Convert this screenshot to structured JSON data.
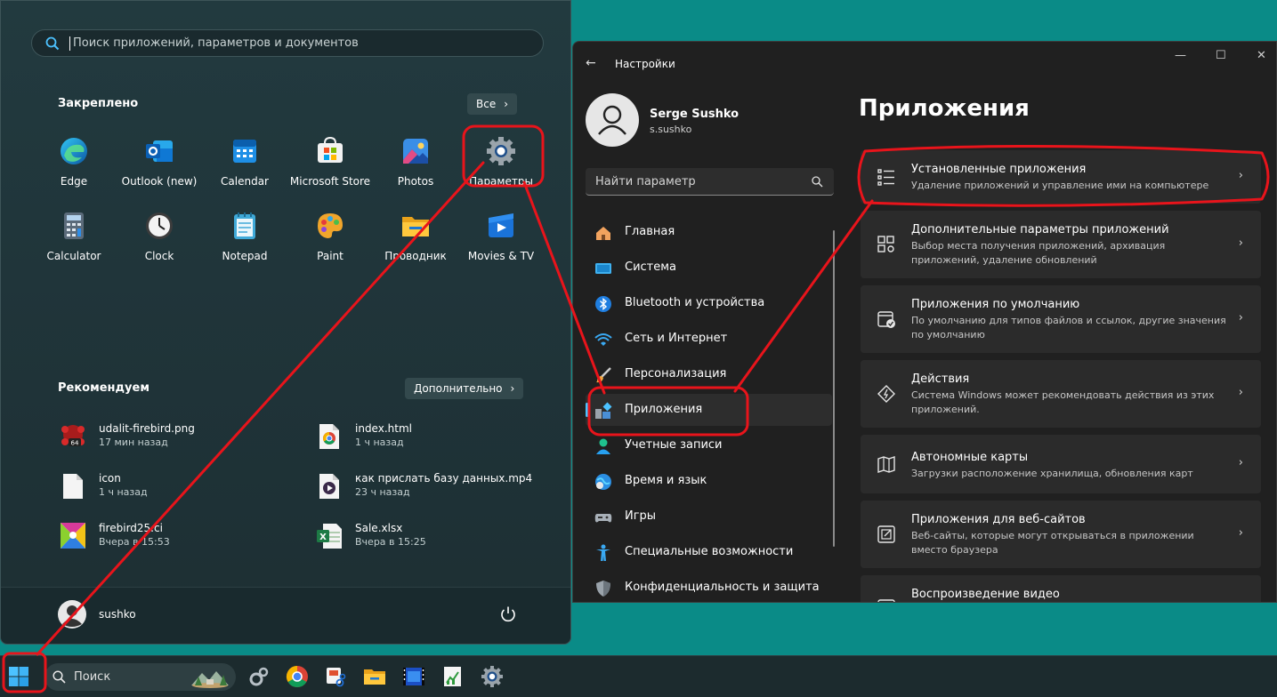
{
  "start_menu": {
    "search_placeholder": "Поиск приложений, параметров и документов",
    "pinned_title": "Закреплено",
    "all_label": "Все",
    "pinned": [
      {
        "label": "Edge",
        "icon": "edge-icon"
      },
      {
        "label": "Outlook (new)",
        "icon": "outlook-icon"
      },
      {
        "label": "Calendar",
        "icon": "calendar-icon"
      },
      {
        "label": "Microsoft Store",
        "icon": "store-icon"
      },
      {
        "label": "Photos",
        "icon": "photos-icon"
      },
      {
        "label": "Параметры",
        "icon": "settings-gear-icon"
      },
      {
        "label": "Calculator",
        "icon": "calculator-icon"
      },
      {
        "label": "Clock",
        "icon": "clock-icon"
      },
      {
        "label": "Notepad",
        "icon": "notepad-icon"
      },
      {
        "label": "Paint",
        "icon": "paint-icon"
      },
      {
        "label": "Проводник",
        "icon": "folder-icon"
      },
      {
        "label": "Movies & TV",
        "icon": "movies-icon"
      }
    ],
    "recommended_title": "Рекомендуем",
    "more_label": "Дополнительно",
    "recommended": [
      {
        "name": "udalit-firebird.png",
        "time": "17 мин назад",
        "icon": "png-file-icon"
      },
      {
        "name": "index.html",
        "time": "1 ч назад",
        "icon": "chrome-html-icon"
      },
      {
        "name": "icon",
        "time": "1 ч назад",
        "icon": "blank-file-icon"
      },
      {
        "name": "как прислать базу данных.mp4",
        "time": "23 ч назад",
        "icon": "video-file-icon"
      },
      {
        "name": "firebird25.ci",
        "time": "Вчера в 15:53",
        "icon": "image-file-icon"
      },
      {
        "name": "Sale.xlsx",
        "time": "Вчера в 15:25",
        "icon": "excel-file-icon"
      }
    ],
    "user_name": "sushko"
  },
  "settings": {
    "window_title": "Настройки",
    "user_full_name": "Serge Sushko",
    "user_login": "s.sushko",
    "search_placeholder": "Найти параметр",
    "page_title": "Приложения",
    "nav": [
      {
        "label": "Главная",
        "icon": "home-icon"
      },
      {
        "label": "Система",
        "icon": "system-icon"
      },
      {
        "label": "Bluetooth и устройства",
        "icon": "bluetooth-icon"
      },
      {
        "label": "Сеть и Интернет",
        "icon": "wifi-icon"
      },
      {
        "label": "Персонализация",
        "icon": "brush-icon"
      },
      {
        "label": "Приложения",
        "icon": "apps-icon",
        "selected": true
      },
      {
        "label": "Учетные записи",
        "icon": "account-icon"
      },
      {
        "label": "Время и язык",
        "icon": "globe-clock-icon"
      },
      {
        "label": "Игры",
        "icon": "gamepad-icon"
      },
      {
        "label": "Специальные возможности",
        "icon": "accessibility-icon"
      },
      {
        "label": "Конфиденциальность и защита",
        "icon": "shield-icon"
      }
    ],
    "cards": [
      {
        "title": "Установленные приложения",
        "desc": "Удаление приложений и управление ими на компьютере",
        "icon": "list-icon"
      },
      {
        "title": "Дополнительные параметры приложений",
        "desc": "Выбор места получения приложений, архивация приложений, удаление обновлений",
        "icon": "apps-settings-icon"
      },
      {
        "title": "Приложения по умолчанию",
        "desc": "По умолчанию для типов файлов и ссылок, другие значения по умолчанию",
        "icon": "default-apps-icon"
      },
      {
        "title": "Действия",
        "desc": "Система Windows может рекомендовать действия из этих приложений.",
        "icon": "actions-icon"
      },
      {
        "title": "Автономные карты",
        "desc": "Загрузки расположение хранилища, обновления карт",
        "icon": "map-icon"
      },
      {
        "title": "Приложения для веб-сайтов",
        "desc": "Веб-сайты, которые могут открываться в приложении вместо браузера",
        "icon": "web-apps-icon"
      },
      {
        "title": "Воспроизведение видео",
        "desc": "",
        "icon": "video-icon"
      }
    ]
  },
  "taskbar": {
    "search_label": "Поиск",
    "apps": [
      "settings-icon",
      "chrome-icon",
      "snipping-tool-icon",
      "file-explorer-icon",
      "movie-maker-icon",
      "notepad-chart-icon",
      "settings-gear-icon"
    ]
  },
  "colors": {
    "annotation": "#e8141b",
    "accent": "#4cc2ff",
    "desktop": "#0a8b87"
  }
}
